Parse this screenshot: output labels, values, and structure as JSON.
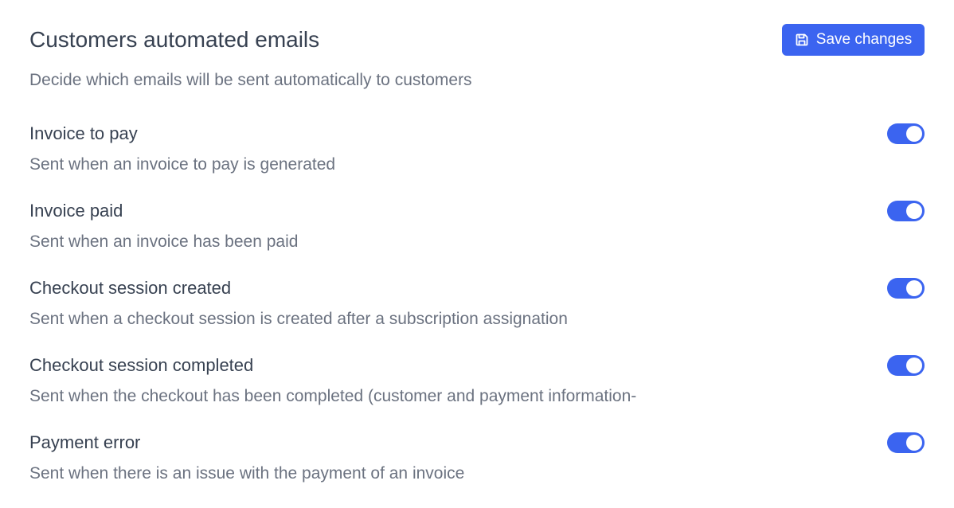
{
  "header": {
    "title": "Customers automated emails",
    "subtitle": "Decide which emails will be sent automatically to customers",
    "save_label": "Save changes"
  },
  "colors": {
    "accent": "#3b64f0",
    "title_text": "#374151",
    "muted_text": "#6b7280"
  },
  "settings": [
    {
      "title": "Invoice to pay",
      "description": "Sent when an invoice to pay is generated",
      "enabled": true
    },
    {
      "title": "Invoice paid",
      "description": "Sent when an invoice has been paid",
      "enabled": true
    },
    {
      "title": "Checkout session created",
      "description": "Sent when a checkout session is created after a subscription assignation",
      "enabled": true
    },
    {
      "title": "Checkout session completed",
      "description": "Sent when the checkout has been completed (customer and payment information-",
      "enabled": true
    },
    {
      "title": "Payment error",
      "description": "Sent when there is an issue with the payment of an invoice",
      "enabled": true
    }
  ]
}
